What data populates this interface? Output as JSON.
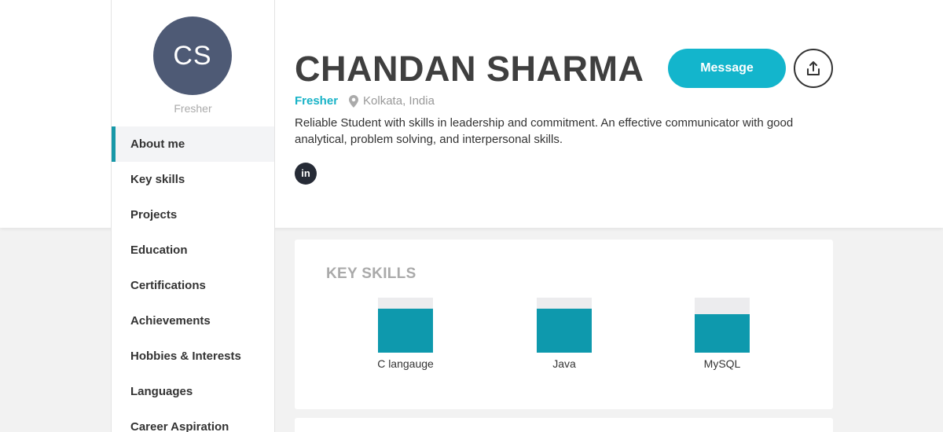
{
  "sidebar": {
    "avatar_initials": "CS",
    "status": "Fresher",
    "items": [
      {
        "label": "About me",
        "active": true
      },
      {
        "label": "Key skills"
      },
      {
        "label": "Projects"
      },
      {
        "label": "Education"
      },
      {
        "label": "Certifications"
      },
      {
        "label": "Achievements"
      },
      {
        "label": "Hobbies & Interests"
      },
      {
        "label": "Languages"
      },
      {
        "label": "Career Aspiration"
      }
    ]
  },
  "profile": {
    "name": "CHANDAN SHARMA",
    "status": "Fresher",
    "location": "Kolkata, India",
    "bio": "Reliable Student with skills in leadership and commitment. An effective communicator with good analytical, problem solving, and interpersonal skills.",
    "linkedin_label": "in"
  },
  "actions": {
    "message_label": "Message",
    "share_icon": "share-icon"
  },
  "key_skills": {
    "title": "KEY SKILLS",
    "skills": [
      {
        "label": "C langauge",
        "level": 0.8
      },
      {
        "label": "Java",
        "level": 0.8
      },
      {
        "label": "MySQL",
        "level": 0.7
      }
    ]
  },
  "colors": {
    "accent": "#13b5cc",
    "bar_fill": "#0e99ad",
    "avatar_bg": "#4e5a75"
  }
}
